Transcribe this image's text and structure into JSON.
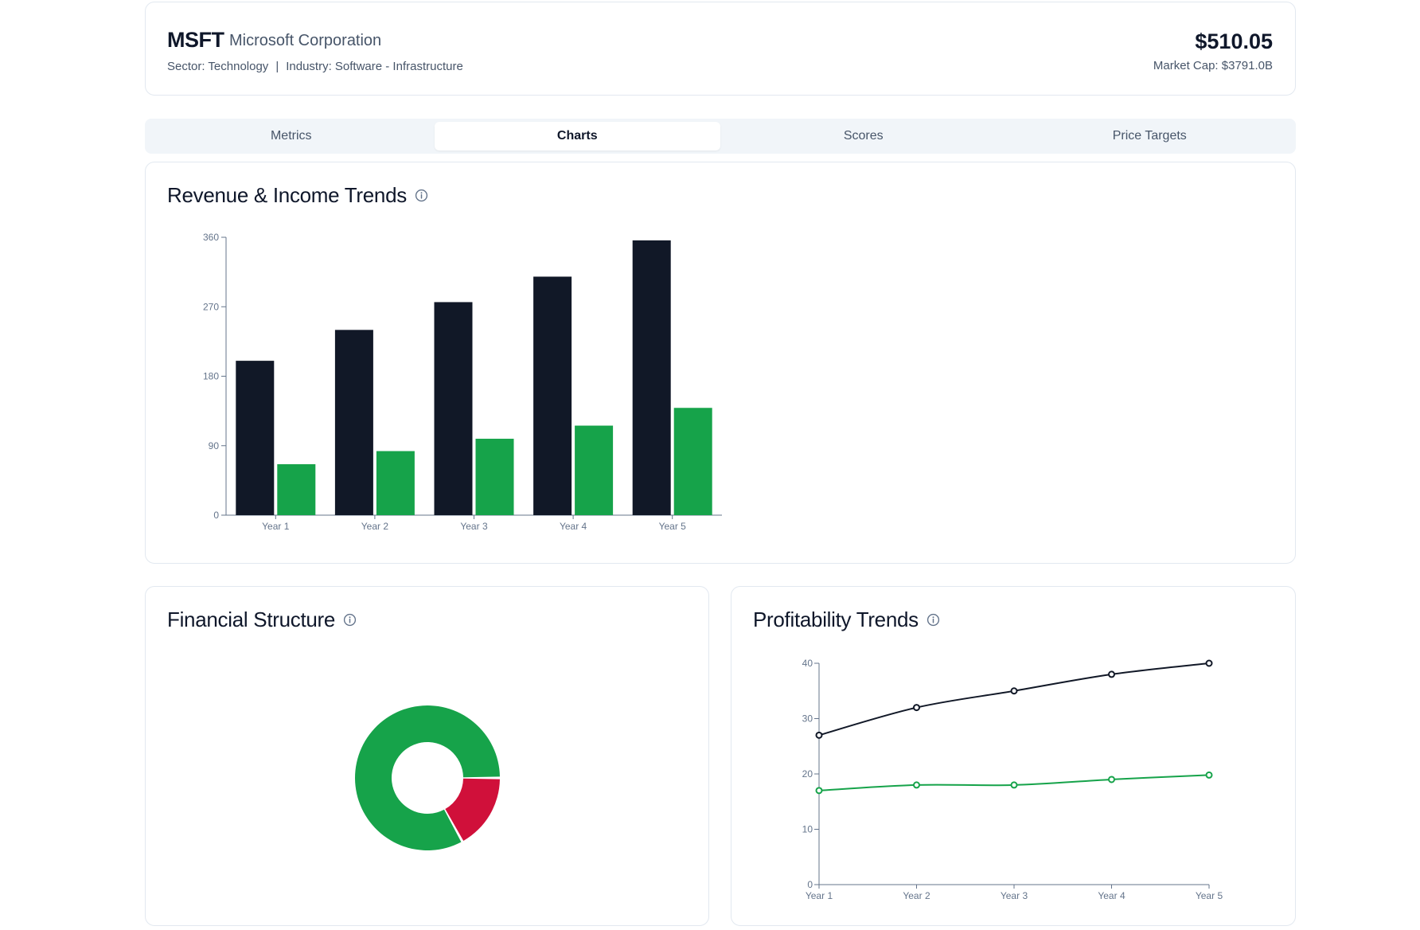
{
  "header": {
    "ticker": "MSFT",
    "company": "Microsoft Corporation",
    "sector": "Sector: Technology",
    "separator": "|",
    "industry": "Industry: Software - Infrastructure",
    "price": "$510.05",
    "market_cap": "Market Cap: $3791.0B"
  },
  "tabs": [
    {
      "label": "Metrics",
      "active": false
    },
    {
      "label": "Charts",
      "active": true
    },
    {
      "label": "Scores",
      "active": false
    },
    {
      "label": "Price Targets",
      "active": false
    }
  ],
  "colors": {
    "dark": "#111827",
    "green": "#16a34a",
    "red": "#d0103a",
    "muted": "#64748b"
  },
  "revenue_card": {
    "title": "Revenue & Income Trends",
    "info_icon": "info-circle-icon"
  },
  "financial_structure_card": {
    "title": "Financial Structure",
    "info_icon": "info-circle-icon"
  },
  "profitability_card": {
    "title": "Profitability Trends",
    "info_icon": "info-circle-icon"
  },
  "chart_data": [
    {
      "type": "bar",
      "categories": [
        "Year 1",
        "Year 2",
        "Year 3",
        "Year 4",
        "Year 5"
      ],
      "series": [
        {
          "values": [
            200,
            240,
            276,
            309,
            356
          ]
        },
        {
          "values": [
            66,
            83,
            99,
            116,
            139
          ]
        }
      ],
      "yticks": [
        0,
        90,
        180,
        270,
        360
      ],
      "ylim": [
        0,
        360
      ],
      "title": "",
      "xlabel": "",
      "ylabel": "",
      "grid": false,
      "legend": "none"
    },
    {
      "type": "pie",
      "donut": true,
      "slices": [
        {
          "value": 83
        },
        {
          "value": 17
        }
      ],
      "title": "",
      "legend": "none"
    },
    {
      "type": "line",
      "categories": [
        "Year 1",
        "Year 2",
        "Year 3",
        "Year 4",
        "Year 5"
      ],
      "series": [
        {
          "values": [
            27,
            32,
            35,
            38,
            40
          ]
        },
        {
          "values": [
            17,
            18,
            18,
            19,
            19.8
          ]
        }
      ],
      "yticks": [
        0,
        10,
        20,
        30,
        40
      ],
      "ylim": [
        0,
        40
      ],
      "title": "",
      "xlabel": "",
      "ylabel": "",
      "grid": false,
      "legend": "none"
    }
  ]
}
